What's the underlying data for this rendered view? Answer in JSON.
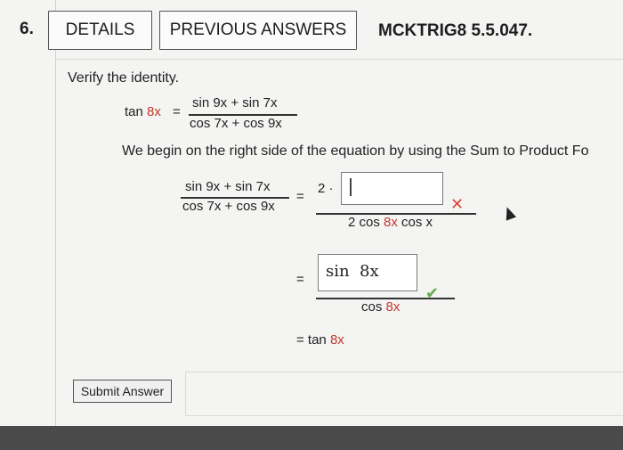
{
  "question_number": "6.",
  "tabs": {
    "details": "DETAILS",
    "previous_answers": "PREVIOUS ANSWERS"
  },
  "problem_code": "MCKTRIG8 5.5.047.",
  "instruction": "Verify the identity.",
  "identity": {
    "lhs_fn": "tan ",
    "lhs_arg": "8x",
    "equals": "=",
    "num": "sin 9x + sin 7x",
    "den": "cos 7x + cos 9x"
  },
  "sentence": "We begin on the right side of the equation by using the Sum to Product Fo",
  "step1": {
    "num": "sin 9x + sin 7x",
    "den": "cos 7x + cos 9x",
    "equals": "=",
    "rhs_coef": "2 ·",
    "rhs_den_a": "2 cos ",
    "rhs_den_b": "8x",
    "rhs_den_c": " cos x",
    "answer_value": "",
    "status": "incorrect"
  },
  "step2": {
    "equals": "=",
    "answer_value": "sin  8x",
    "den_fn": "cos ",
    "den_arg": "8x",
    "status": "correct"
  },
  "step3": {
    "equals": "= tan ",
    "arg": "8x"
  },
  "submit_label": "Submit Answer",
  "colors": {
    "incorrect": "#d9473b",
    "correct": "#6aa84f",
    "highlight": "#c0392b"
  }
}
